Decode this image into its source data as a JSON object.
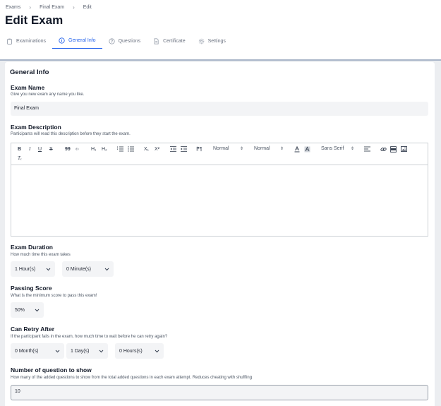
{
  "breadcrumb": [
    "Exams",
    "Final Exam",
    "Edit"
  ],
  "page_title": "Edit Exam",
  "tabs": [
    {
      "label": "Examinations",
      "icon": "clipboard-icon"
    },
    {
      "label": "General Info",
      "icon": "info-icon",
      "active": true
    },
    {
      "label": "Questions",
      "icon": "question-icon"
    },
    {
      "label": "Certificate",
      "icon": "certificate-icon"
    },
    {
      "label": "Settings",
      "icon": "gear-icon"
    }
  ],
  "form": {
    "section_title": "General Info",
    "name": {
      "label": "Exam Name",
      "help": "Give you new exam any name you like.",
      "value": "Final Exam"
    },
    "description": {
      "label": "Exam Description",
      "help": "Participants will read this description before they start the exam.",
      "toolbar": {
        "bold": "B",
        "italic": "I",
        "underline": "U",
        "strike": "S",
        "quote": "99",
        "code": "‹›",
        "h1": "H₁",
        "h2": "H₂",
        "sub": "X₁",
        "sup": "X²",
        "rtl": "⁋¶",
        "size_select": "Normal",
        "header_select": "Normal",
        "font_select": "Sans Serif",
        "clear": "Tₓ"
      },
      "value": ""
    },
    "duration": {
      "label": "Exam Duration",
      "help": "How much time this exam takes",
      "hours": "1 Hour(s)",
      "minutes": "0 Minute(s)"
    },
    "passing": {
      "label": "Passing Score",
      "help": "What is the minimum score to pass this exam!",
      "value": "50%"
    },
    "retry": {
      "label": "Can Retry After",
      "help": "If the participant fails in the exam, how much time to wait before he can retry again?",
      "months": "0 Month(s)",
      "days": "1 Day(s)",
      "hours": "0 Hours(s)"
    },
    "question_count": {
      "label": "Number of question to show",
      "help": "How many of the added questions to show from the total added questions in each exam attempt. Reduces cheating with shuffling",
      "value": "10"
    }
  },
  "colors": {
    "accent": "#2563eb",
    "field_bg": "#f3f4f6",
    "page_bg": "#eceef1"
  }
}
